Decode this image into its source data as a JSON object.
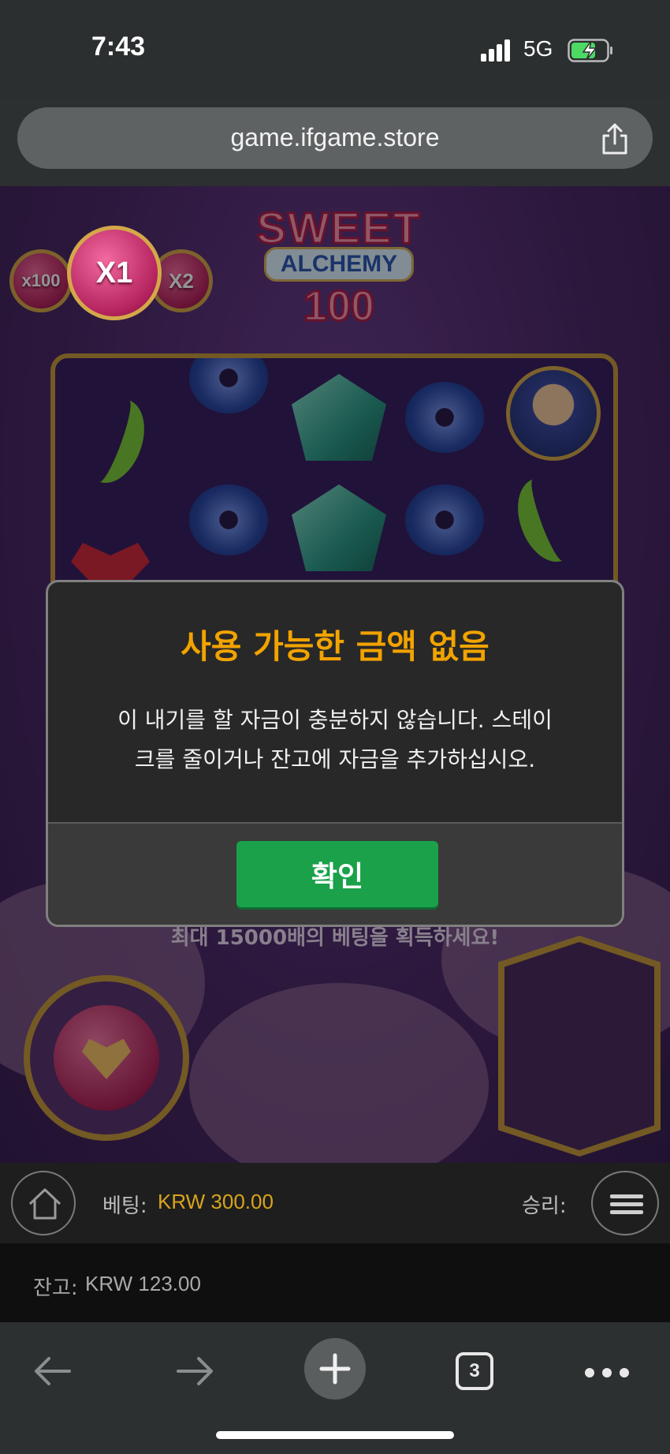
{
  "status_bar": {
    "time": "7:43",
    "network": "5G"
  },
  "browser": {
    "url": "game.ifgame.store",
    "tab_count": "3"
  },
  "game": {
    "multipliers": [
      "x100",
      "X1",
      "X2"
    ],
    "logo": {
      "line1": "SWEET",
      "line2": "ALCHEMY",
      "line3": "100"
    },
    "promo_text": "최대 15000배의 베팅을 획득하세요!"
  },
  "modal": {
    "title": "사용 가능한 금액 없음",
    "message_line1": "이 내기를 할 자금이 충분하지 않습니다. 스테이",
    "message_line2": "크를 줄이거나 잔고에 자금을 추가하십시오.",
    "ok_label": "확인"
  },
  "bet_bar": {
    "bet_label": "베팅:",
    "bet_value": "KRW 300.00",
    "win_label": "승리:"
  },
  "balance_bar": {
    "label": "잔고:",
    "value": "KRW 123.00"
  },
  "colors": {
    "accent_title": "#f2a300",
    "ok_button": "#1aa14a",
    "bet_value": "#d9a41c"
  }
}
